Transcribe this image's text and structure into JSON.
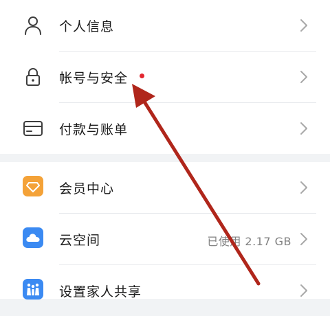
{
  "settings": {
    "group1": [
      {
        "label": "个人信息",
        "icon": "person-icon"
      },
      {
        "label": "帐号与安全",
        "icon": "lock-icon",
        "badge": true,
        "badge_color": "#e3262f"
      },
      {
        "label": "付款与账单",
        "icon": "card-icon"
      }
    ],
    "group2": [
      {
        "label": "会员中心",
        "icon": "diamond-icon",
        "icon_color": "#f4a238"
      },
      {
        "label": "云空间",
        "icon": "cloud-icon",
        "icon_color": "#3b8af2",
        "value": "已使用 2.17 GB"
      },
      {
        "label": "设置家人共享",
        "icon": "family-icon",
        "icon_color": "#3b8af2"
      }
    ]
  },
  "annotation": {
    "arrow_color": "#b0261b"
  }
}
